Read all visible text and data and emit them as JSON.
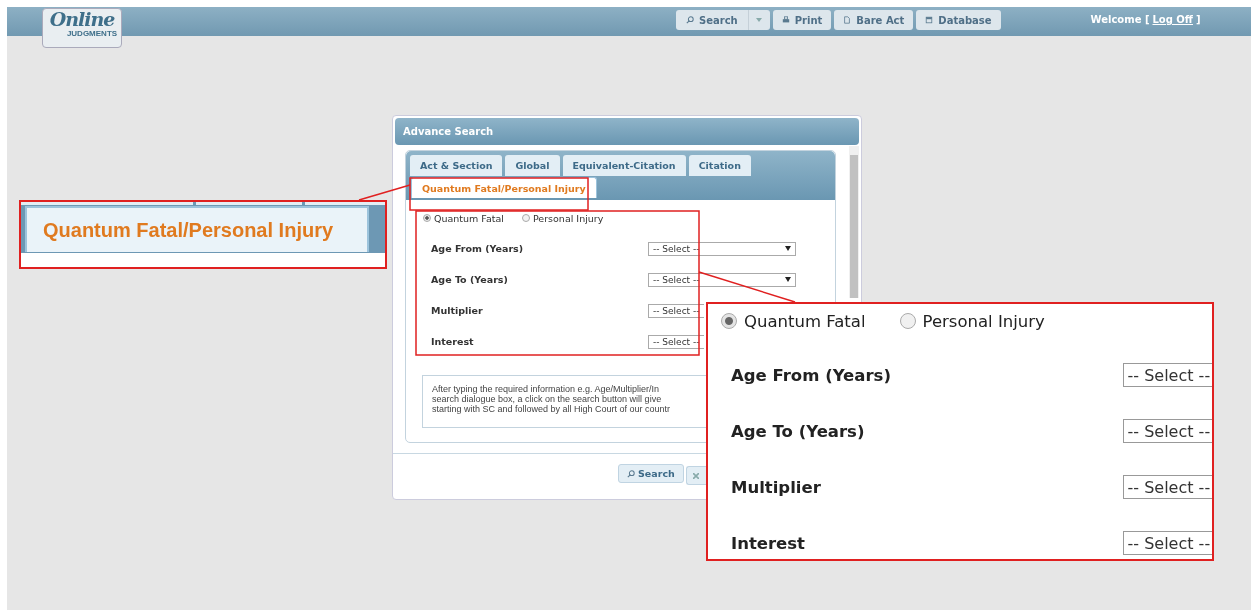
{
  "logo": {
    "script": "Online",
    "wordmark": "JUDGMENTS"
  },
  "toolbar": [
    {
      "kind": "search",
      "label": "Search",
      "dropdown": true
    },
    {
      "kind": "print",
      "label": "Print",
      "dropdown": false
    },
    {
      "kind": "page",
      "label": "Bare Act",
      "dropdown": false
    },
    {
      "kind": "database",
      "label": "Database",
      "dropdown": false
    }
  ],
  "welcome": {
    "text": "Welcome [",
    "link": "Log Off",
    "suffix": "]"
  },
  "dialog": {
    "title": "Advance Search",
    "tab_rows": [
      [
        {
          "label": "Act & Section",
          "selected": false
        },
        {
          "label": "Global",
          "selected": false
        },
        {
          "label": "Equivalent-Citation",
          "selected": false
        },
        {
          "label": "Citation",
          "selected": false
        }
      ],
      [
        {
          "label": "Quantum Fatal/Personal Injury",
          "selected": true
        }
      ]
    ],
    "radios": [
      {
        "label": "Quantum Fatal",
        "selected": true
      },
      {
        "label": "Personal Injury",
        "selected": false
      }
    ],
    "fields": [
      {
        "label": "Age From (Years)",
        "value": "-- Select --"
      },
      {
        "label": "Age To (Years)",
        "value": "-- Select --"
      },
      {
        "label": "Multiplier",
        "value": "-- Select --"
      },
      {
        "label": "Interest",
        "value": "-- Select --"
      }
    ],
    "help_text": "After typing the required information e.g. Age/Multiplier/In\nsearch dialogue box, a click on the search button will give\nstarting with SC and followed by all High Court of our countr",
    "search_button": "Search"
  },
  "callout_tab": {
    "label": "Quantum Fatal/Personal Injury",
    "selected": true
  },
  "callout_form": {
    "radios": [
      {
        "label": "Quantum Fatal",
        "selected": true
      },
      {
        "label": "Personal Injury",
        "selected": false
      }
    ],
    "fields": [
      {
        "label": "Age From (Years)",
        "value": "-- Select --"
      },
      {
        "label": "Age To (Years)",
        "value": "-- Select --"
      },
      {
        "label": "Multiplier",
        "value": "-- Select --"
      },
      {
        "label": "Interest",
        "value": "-- Select --"
      }
    ]
  }
}
